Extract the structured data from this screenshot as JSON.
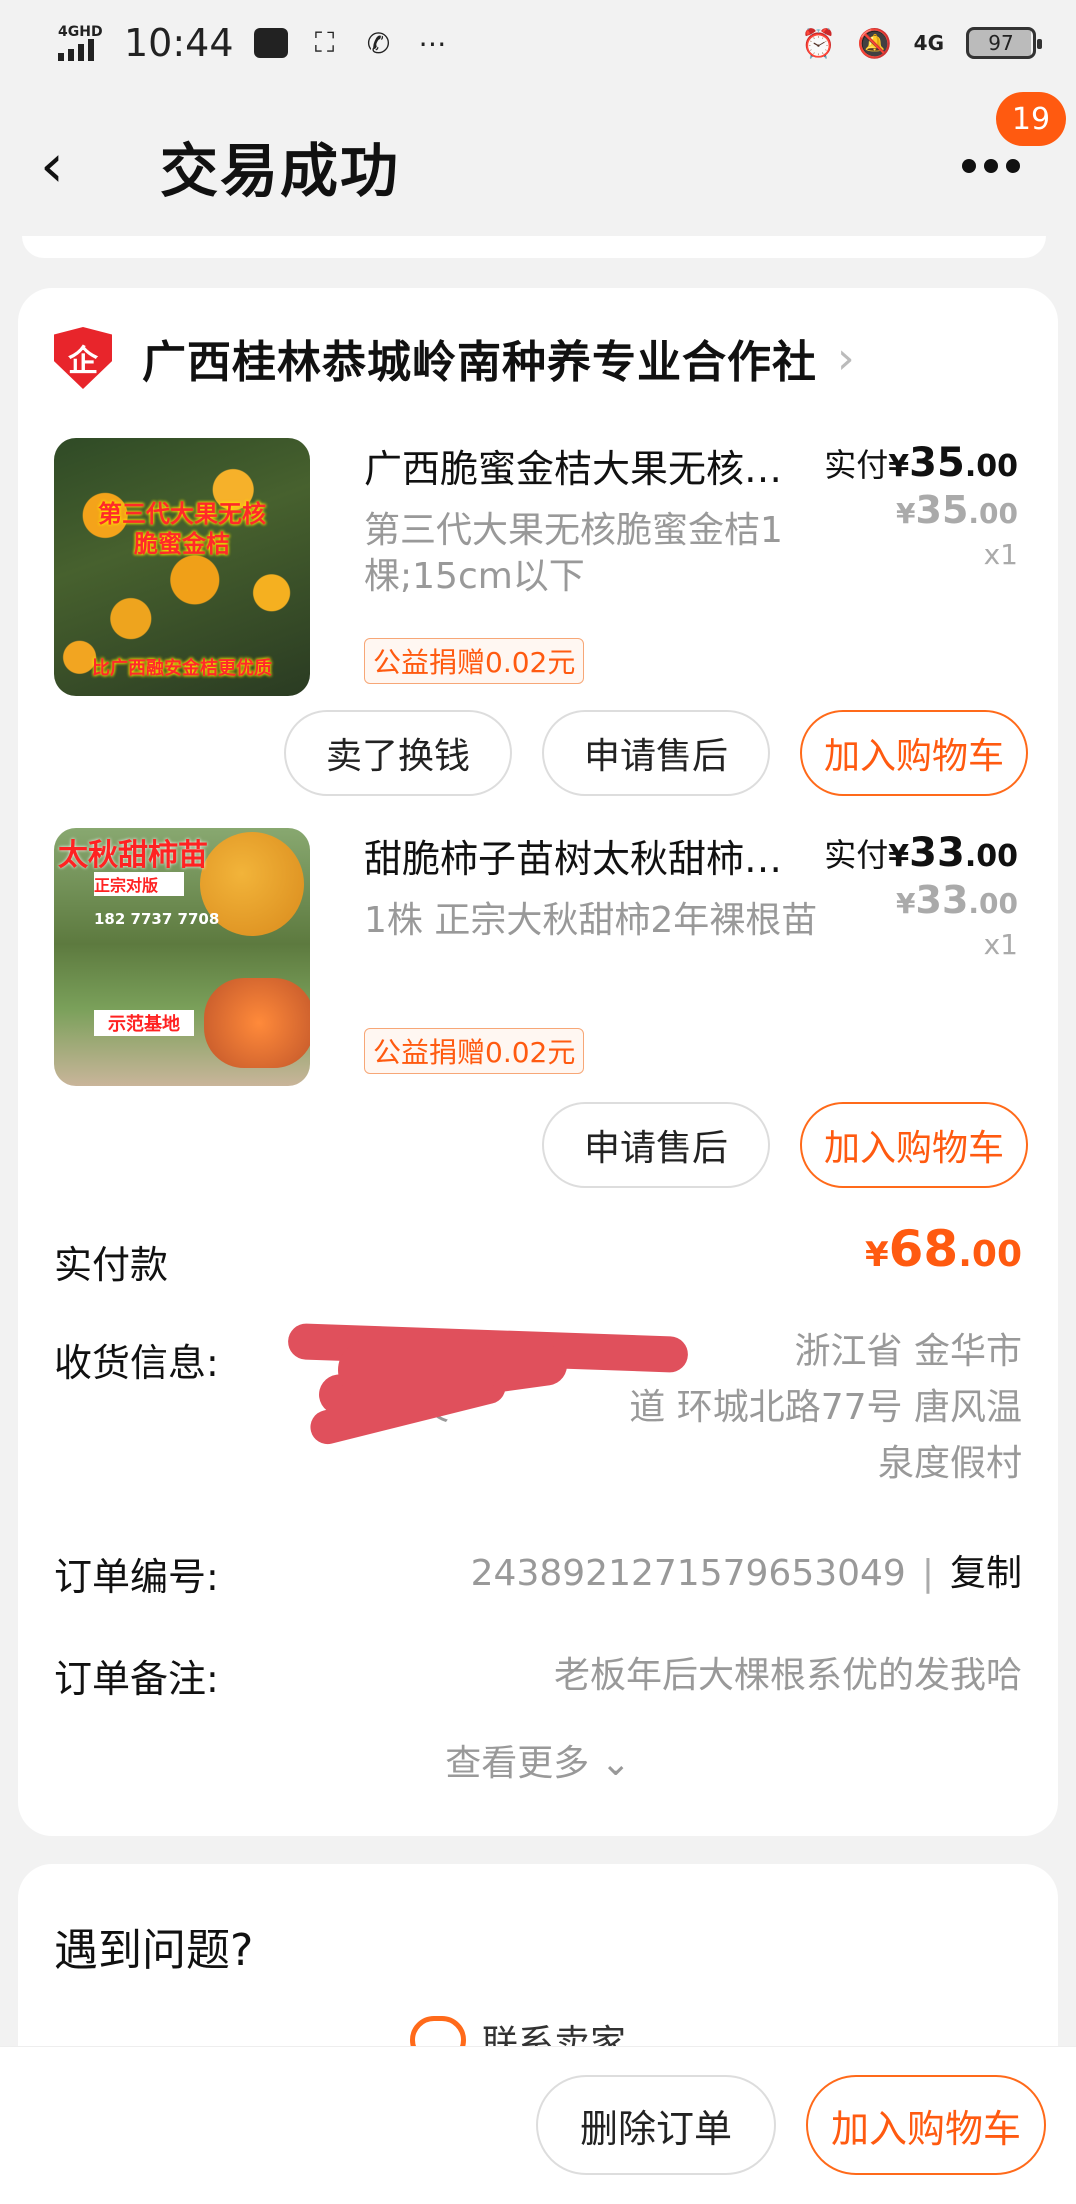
{
  "status_bar": {
    "network": "4GHD",
    "time": "10:44",
    "right_network": "4G",
    "battery": "97"
  },
  "header": {
    "title": "交易成功",
    "back_glyph": "‹",
    "badge_count": "19"
  },
  "shop": {
    "icon_text": "企",
    "name": "广西桂林恭城岭南种养专业合作社",
    "chevron": "›"
  },
  "items": [
    {
      "title": "广西脆蜜金桔大果无核肥蜜金桔",
      "sku": "第三代大果无核脆蜜金桔1棵;15cm以下",
      "tag": "公益捐赠0.02元",
      "paid_label": "实付",
      "paid_yen": "¥",
      "paid_int": "35",
      "paid_dec": ".00",
      "orig_yen": "¥",
      "orig_int": "35",
      "orig_dec": ".00",
      "qty": "x1",
      "thumb_caption_top": "第三代大果无核",
      "thumb_caption_mid": "脆蜜金桔",
      "thumb_caption_bottom": "比广西融安金桔更优质",
      "buttons": [
        "卖了换钱",
        "申请售后",
        "加入购物车"
      ]
    },
    {
      "title": "甜脆柿子苗树太秋甜柿嫁接苗",
      "sku": "1株 正宗大秋甜柿2年裸根苗",
      "tag": "公益捐赠0.02元",
      "paid_label": "实付",
      "paid_yen": "¥",
      "paid_int": "33",
      "paid_dec": ".00",
      "orig_yen": "¥",
      "orig_int": "33",
      "orig_dec": ".00",
      "qty": "x1",
      "thumb_caption_top": "太秋甜柿苗",
      "thumb_caption_mid": "正宗对版",
      "thumb_caption_phone": "182 7737 7708",
      "thumb_caption_bottom": "示范基地",
      "buttons": [
        "申请售后",
        "加入购物车"
      ]
    }
  ],
  "summary": {
    "total_label": "实付款",
    "total_yen": "¥",
    "total_int": "68",
    "total_dec": ".00",
    "address_label": "收货信息:",
    "address_line1": "户睫，　　　　　　　　浙江省 金华市",
    "address_line2": "武义　　　　　道 环城北路77号 唐风温",
    "address_line3": "泉度假村",
    "order_no_label": "订单编号:",
    "order_no": "2438921271579653049",
    "separator": "|",
    "copy_label": "复制",
    "remark_label": "订单备注:",
    "remark": "老板年后大棵根系优的发我哈",
    "see_more": "查看更多 ⌄"
  },
  "problem": {
    "title": "遇到问题?",
    "contact_label": "联系卖家"
  },
  "bottom_bar": {
    "delete_label": "删除订单",
    "add_cart_label": "加入购物车"
  },
  "colors": {
    "accent": "#ff5a10",
    "redaction": "#e0505c"
  }
}
